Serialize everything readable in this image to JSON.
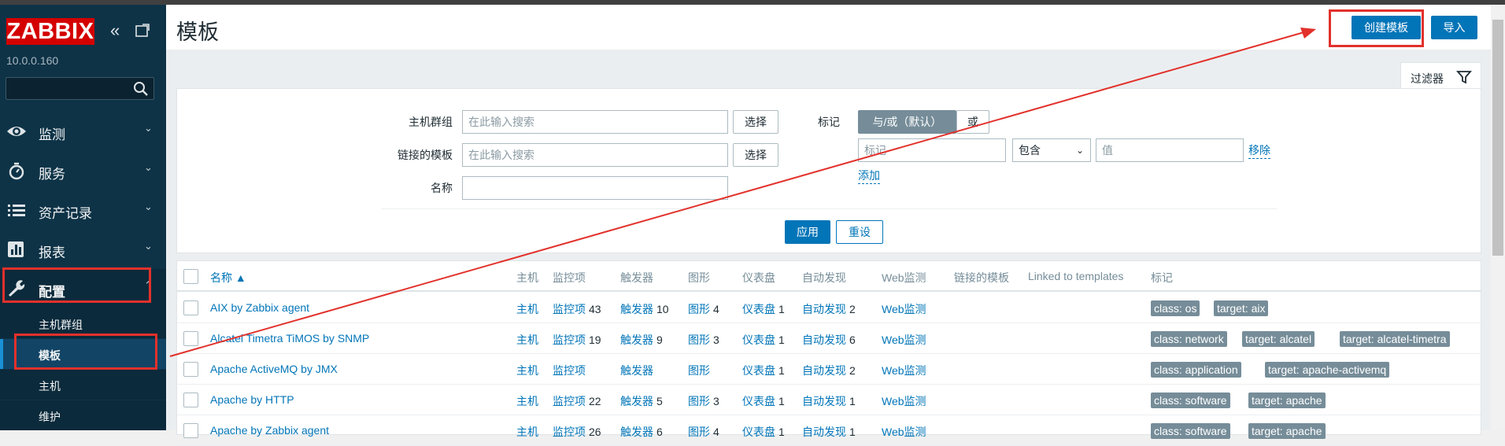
{
  "app": {
    "logo": "ZABBIX",
    "server_ip": "10.0.0.160",
    "search_placeholder": ""
  },
  "sidebar": {
    "menus": [
      {
        "label": "监测",
        "icon": "eye-icon"
      },
      {
        "label": "服务",
        "icon": "stopwatch-icon"
      },
      {
        "label": "资产记录",
        "icon": "list-icon"
      },
      {
        "label": "报表",
        "icon": "bar-chart-icon"
      },
      {
        "label": "配置",
        "icon": "wrench-icon"
      }
    ],
    "submenu": [
      "主机群组",
      "模板",
      "主机",
      "维护"
    ]
  },
  "header": {
    "title": "模板",
    "create_label": "创建模板",
    "import_label": "导入"
  },
  "filter": {
    "tab_label": "过滤器",
    "host_group_label": "主机群组",
    "host_group_placeholder": "在此输入搜索",
    "linked_label": "链接的模板",
    "linked_placeholder": "在此输入搜索",
    "name_label": "名称",
    "select_label": "选择",
    "tag_label": "标记",
    "and_or_label": "与/或（默认）",
    "or_label": "或",
    "tag_placeholder": "标记",
    "operator_value": "包含",
    "value_placeholder": "值",
    "remove_label": "移除",
    "add_label": "添加",
    "apply_label": "应用",
    "reset_label": "重设"
  },
  "table": {
    "headers": [
      "名称 ▲",
      "主机",
      "监控项",
      "触发器",
      "图形",
      "仪表盘",
      "自动发现",
      "Web监测",
      "链接的模板",
      "Linked to templates",
      "标记"
    ],
    "rows": [
      {
        "name": "AIX by Zabbix agent",
        "hosts": "主机",
        "items": "监控项",
        "items_n": "43",
        "triggers": "触发器",
        "triggers_n": "10",
        "graphs": "图形",
        "graphs_n": "4",
        "dashboards": "仪表盘",
        "dashboards_n": "1",
        "discovery": "自动发现",
        "discovery_n": "2",
        "web": "Web监测",
        "tags": [
          "class: os",
          "target: aix"
        ]
      },
      {
        "name": "Alcatel Timetra TiMOS by SNMP",
        "hosts": "主机",
        "items": "监控项",
        "items_n": "19",
        "triggers": "触发器",
        "triggers_n": "9",
        "graphs": "图形",
        "graphs_n": "3",
        "dashboards": "仪表盘",
        "dashboards_n": "1",
        "discovery": "自动发现",
        "discovery_n": "6",
        "web": "Web监测",
        "tags": [
          "class: network",
          "target: alcatel",
          "target: alcatel-timetra"
        ]
      },
      {
        "name": "Apache ActiveMQ by JMX",
        "hosts": "主机",
        "items": "监控项",
        "items_n": "",
        "triggers": "触发器",
        "triggers_n": "",
        "graphs": "图形",
        "graphs_n": "",
        "dashboards": "仪表盘",
        "dashboards_n": "1",
        "discovery": "自动发现",
        "discovery_n": "2",
        "web": "Web监测",
        "tags": [
          "class: application",
          "target: apache-activemq"
        ]
      },
      {
        "name": "Apache by HTTP",
        "hosts": "主机",
        "items": "监控项",
        "items_n": "22",
        "triggers": "触发器",
        "triggers_n": "5",
        "graphs": "图形",
        "graphs_n": "3",
        "dashboards": "仪表盘",
        "dashboards_n": "1",
        "discovery": "自动发现",
        "discovery_n": "1",
        "web": "Web监测",
        "tags": [
          "class: software",
          "target: apache"
        ]
      },
      {
        "name": "Apache by Zabbix agent",
        "hosts": "主机",
        "items": "监控项",
        "items_n": "26",
        "triggers": "触发器",
        "triggers_n": "6",
        "graphs": "图形",
        "graphs_n": "4",
        "dashboards": "仪表盘",
        "dashboards_n": "1",
        "discovery": "自动发现",
        "discovery_n": "1",
        "web": "Web监测",
        "tags": [
          "class: software",
          "target: apache"
        ]
      }
    ]
  },
  "colors": {
    "sidebar_bg": "#0e3347",
    "accent": "#0275b8",
    "annotation": "#e2312b",
    "logo_bg": "#d40000",
    "tag_bg": "#768d99"
  }
}
